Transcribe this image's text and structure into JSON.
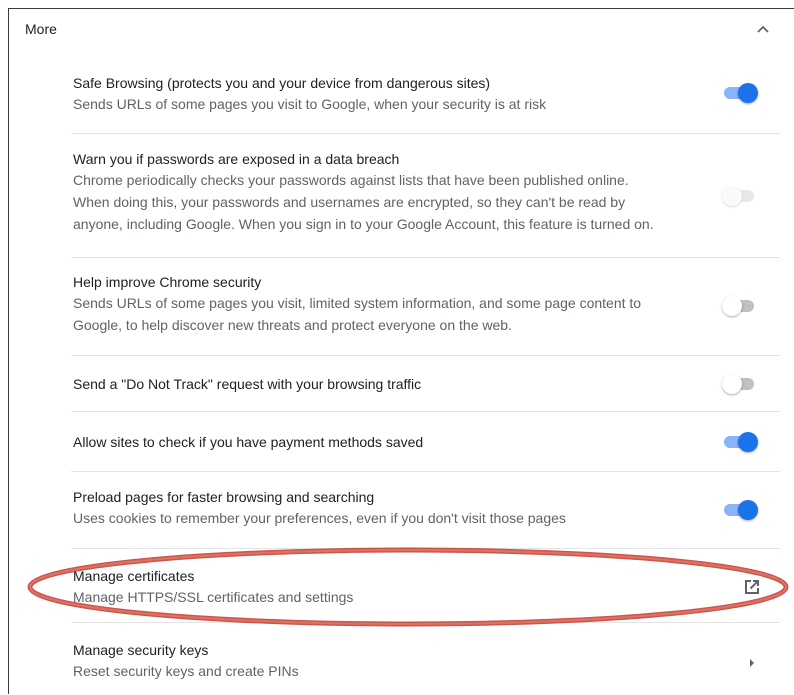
{
  "section": {
    "title": "More"
  },
  "rows": [
    {
      "primary": "Safe Browsing (protects you and your device from dangerous sites)",
      "secondary": [
        "Sends URLs of some pages you visit to Google, when your security is at risk"
      ],
      "control": "toggle",
      "state": "on"
    },
    {
      "primary": "Warn you if passwords are exposed in a data breach",
      "secondary": [
        "Chrome periodically checks your passwords against lists that have been published online.",
        "When doing this, your passwords and usernames are encrypted, so they can't be read by",
        "anyone, including Google. When you sign in to your Google Account, this feature is turned on."
      ],
      "control": "toggle",
      "state": "disabled-off"
    },
    {
      "primary": "Help improve Chrome security",
      "secondary": [
        "Sends URLs of some pages you visit, limited system information, and some page content to",
        "Google, to help discover new threats and protect everyone on the web."
      ],
      "control": "toggle",
      "state": "off"
    },
    {
      "primary": "Send a \"Do Not Track\" request with your browsing traffic",
      "secondary": [],
      "control": "toggle",
      "state": "off"
    },
    {
      "primary": "Allow sites to check if you have payment methods saved",
      "secondary": [],
      "control": "toggle",
      "state": "on"
    },
    {
      "primary": "Preload pages for faster browsing and searching",
      "secondary": [
        "Uses cookies to remember your preferences, even if you don't visit those pages"
      ],
      "control": "toggle",
      "state": "on"
    },
    {
      "primary": "Manage certificates",
      "secondary": [
        "Manage HTTPS/SSL certificates and settings"
      ],
      "control": "external-link-icon"
    },
    {
      "primary": "Manage security keys",
      "secondary": [
        "Reset security keys and create PINs"
      ],
      "control": "arrow-right-icon"
    }
  ],
  "colors": {
    "toggle_on": "#1a73e8",
    "toggle_on_track": "#8ab4f8",
    "annotation_ellipse": "#d9534f"
  }
}
